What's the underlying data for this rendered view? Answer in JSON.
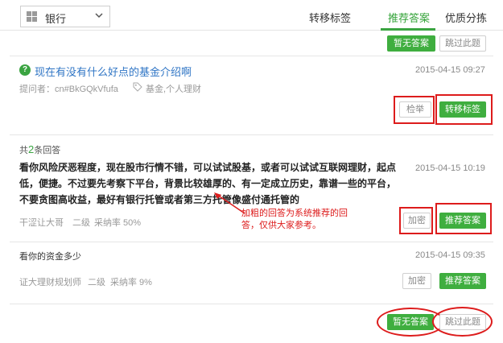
{
  "header": {
    "category": "银行",
    "tabs": [
      {
        "label": "转移标签",
        "active": false
      },
      {
        "label": "推荐答案",
        "active": true
      },
      {
        "label": "优质分拣",
        "active": false
      }
    ]
  },
  "top_actions": {
    "no_answer": "暂无答案",
    "skip": "跳过此题"
  },
  "question": {
    "icon_text": "?",
    "title": "现在有没有什么好点的基金介绍啊",
    "date": "2015-04-15 09:27",
    "asker": "提问者：cn#BkGQkVfufa",
    "tags": "基金,个人理财",
    "report_label": "检举",
    "move_tag_label": "转移标签"
  },
  "answers_count": {
    "prefix": "共",
    "count": "2",
    "suffix": "条回答"
  },
  "answers": [
    {
      "text": "看你风险厌恶程度，现在股市行情不错，可以试试股基，或者可以试试互联网理财，起点低，便捷。不过要先考察下平台，背景比较雄厚的、有一定成立历史，靠谱一些的平台，不要贪图高收益，最好有银行托管或者第三方托管像盛付通托管的",
      "date": "2015-04-15 10:19",
      "author": "干涩让大哥",
      "level": "二级",
      "adopt_rate": "采纳率 50%",
      "encrypt_label": "加密",
      "recommend_label": "推荐答案"
    },
    {
      "text": "看你的资金多少",
      "date": "2015-04-15 09:35",
      "author": "证大理财规划师",
      "level": "二级",
      "adopt_rate": "采纳率 9%",
      "encrypt_label": "加密",
      "recommend_label": "推荐答案"
    }
  ],
  "annotation_note": "加粗的回答为系统推荐的回答，仅供大家参考。",
  "bottom_actions": {
    "no_answer": "暂无答案",
    "skip": "跳过此题"
  },
  "colors": {
    "accent_green": "#3aa441",
    "link_blue": "#2f75c5",
    "highlight_red": "#dd1c1c"
  }
}
